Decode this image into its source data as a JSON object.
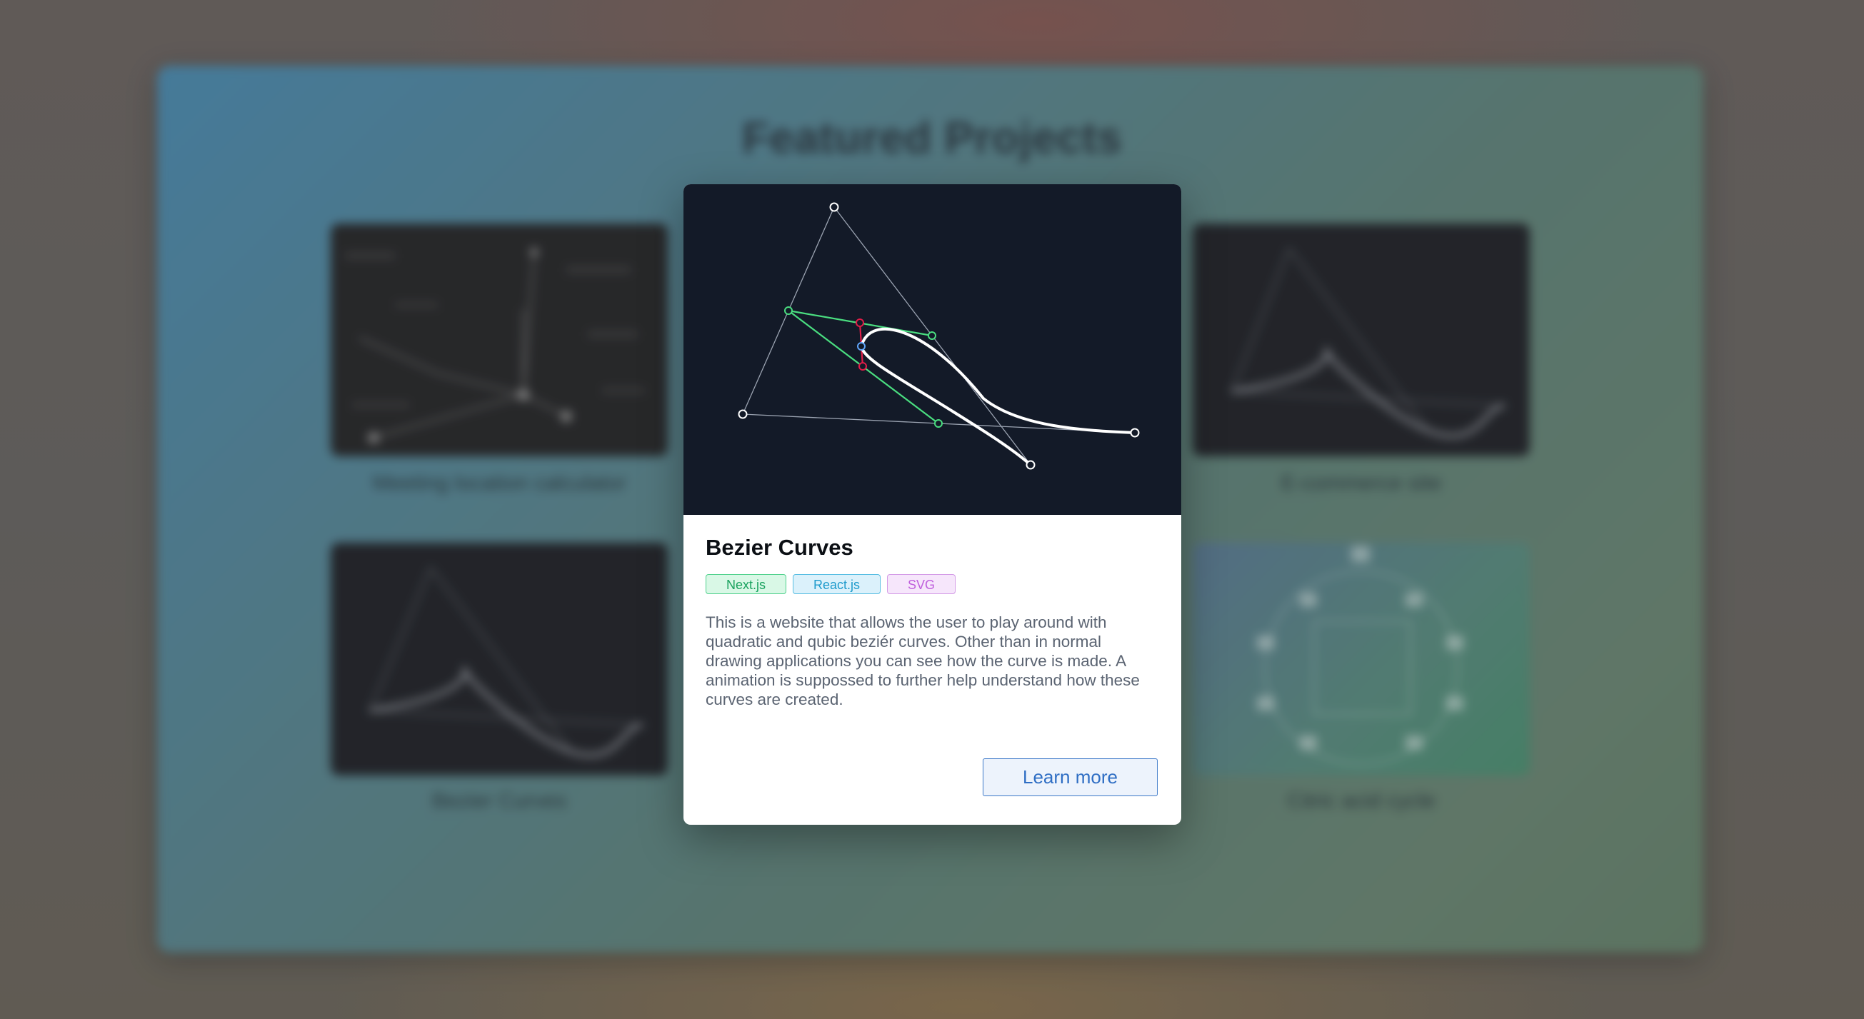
{
  "background": {
    "section_title": "Featured Projects",
    "projects": [
      {
        "label": "Meeting location calculator"
      },
      {
        "label": "E-commerce site"
      },
      {
        "label": "Bezier Curves"
      },
      {
        "label": "Citric acid cycle"
      }
    ]
  },
  "modal": {
    "title": "Bezier Curves",
    "tags": [
      "Next.js",
      "React.js",
      "SVG"
    ],
    "description": "This is a website that allows the user to play around with quadratic and qubic beziér curves. Other than in normal drawing applications you can see how the curve is made. A animation is suppossed to further help understand how these curves are created.",
    "learn_more_label": "Learn more"
  },
  "colors": {
    "accent": "#2f6ec4",
    "construction_green": "#4ade80",
    "construction_red": "#e11d48",
    "curve": "#ffffff",
    "image_bg": "#131a28"
  },
  "icons": {
    "control_point": "circle-handle"
  }
}
